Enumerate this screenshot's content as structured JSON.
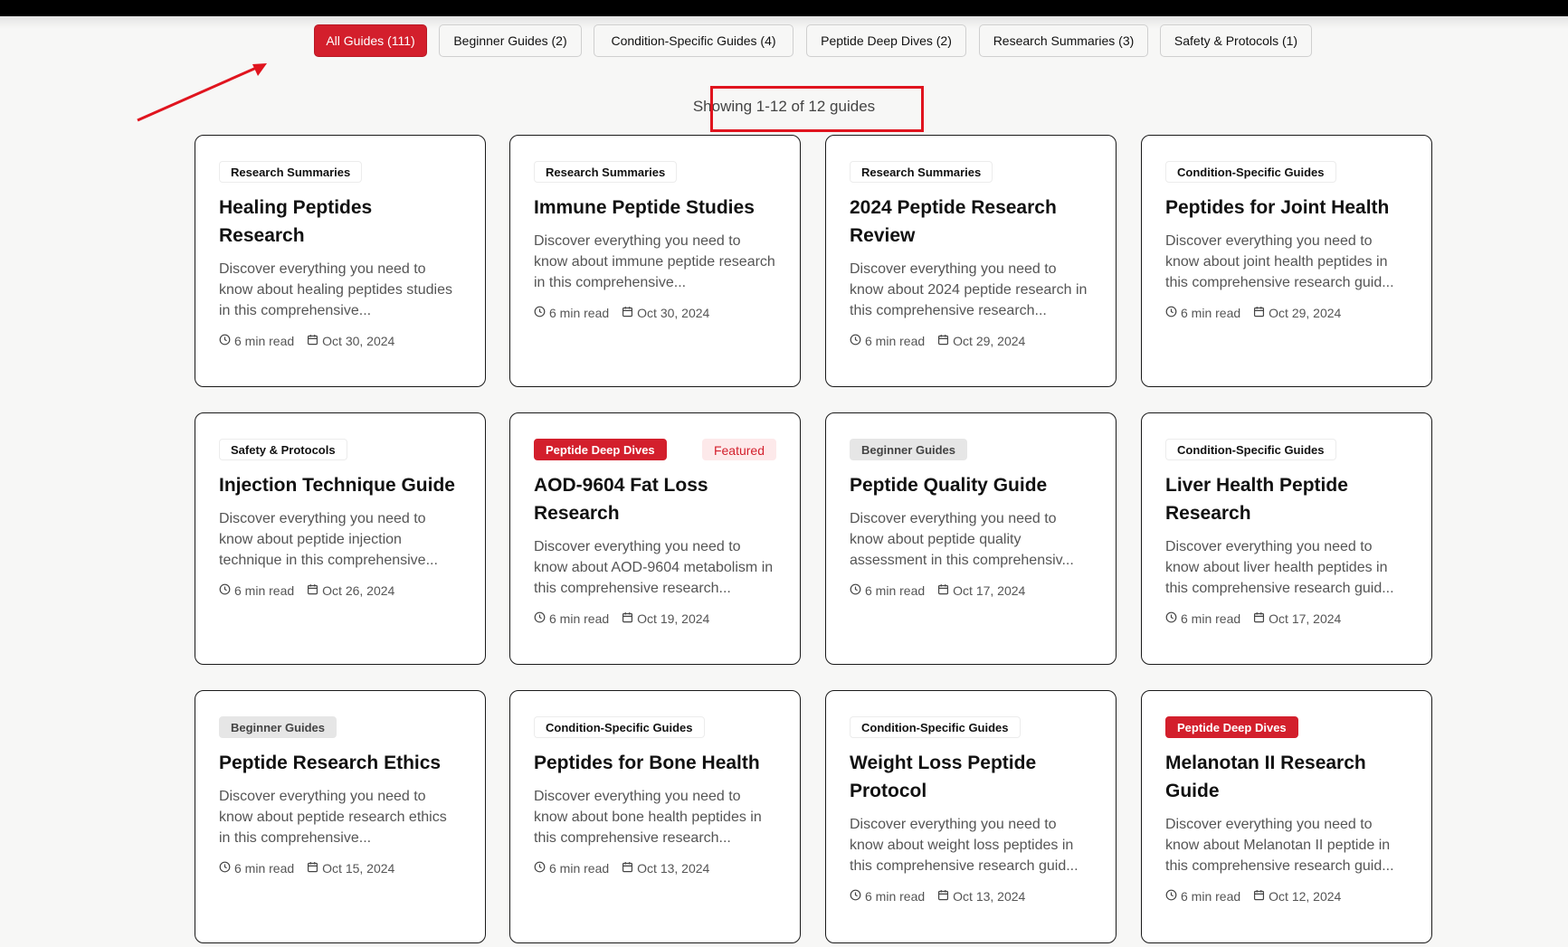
{
  "filters": [
    {
      "label": "All Guides (111)",
      "active": true
    },
    {
      "label": "Beginner Guides (2)",
      "active": false
    },
    {
      "label": "Condition-Specific Guides (4)",
      "active": false
    },
    {
      "label": "Peptide Deep Dives (2)",
      "active": false
    },
    {
      "label": "Research Summaries (3)",
      "active": false
    },
    {
      "label": "Safety & Protocols (1)",
      "active": false
    }
  ],
  "showing_text": "Showing 1-12 of 12 guides",
  "guides": [
    {
      "category": "Research Summaries",
      "category_style": "plain",
      "featured": "",
      "title": "Healing Peptides Research",
      "desc": "Discover everything you need to know about healing peptides studies in this comprehensive...",
      "read_time": "6 min read",
      "date": "Oct 30, 2024"
    },
    {
      "category": "Research Summaries",
      "category_style": "plain",
      "featured": "",
      "title": "Immune Peptide Studies",
      "desc": "Discover everything you need to know about immune peptide research in this comprehensive...",
      "read_time": "6 min read",
      "date": "Oct 30, 2024"
    },
    {
      "category": "Research Summaries",
      "category_style": "plain",
      "featured": "",
      "title": "2024 Peptide Research Review",
      "desc": "Discover everything you need to know about 2024 peptide research in this comprehensive research...",
      "read_time": "6 min read",
      "date": "Oct 29, 2024"
    },
    {
      "category": "Condition-Specific Guides",
      "category_style": "plain",
      "featured": "",
      "title": "Peptides for Joint Health",
      "desc": "Discover everything you need to know about joint health peptides in this comprehensive research guid...",
      "read_time": "6 min read",
      "date": "Oct 29, 2024"
    },
    {
      "category": "Safety & Protocols",
      "category_style": "plain",
      "featured": "",
      "title": "Injection Technique Guide",
      "desc": "Discover everything you need to know about peptide injection technique in this comprehensive...",
      "read_time": "6 min read",
      "date": "Oct 26, 2024"
    },
    {
      "category": "Peptide Deep Dives",
      "category_style": "red",
      "featured": "Featured",
      "title": "AOD-9604 Fat Loss Research",
      "desc": "Discover everything you need to know about AOD-9604 metabolism in this comprehensive research...",
      "read_time": "6 min read",
      "date": "Oct 19, 2024"
    },
    {
      "category": "Beginner Guides",
      "category_style": "gray",
      "featured": "",
      "title": "Peptide Quality Guide",
      "desc": "Discover everything you need to know about peptide quality assessment in this comprehensiv...",
      "read_time": "6 min read",
      "date": "Oct 17, 2024"
    },
    {
      "category": "Condition-Specific Guides",
      "category_style": "plain",
      "featured": "",
      "title": "Liver Health Peptide Research",
      "desc": "Discover everything you need to know about liver health peptides in this comprehensive research guid...",
      "read_time": "6 min read",
      "date": "Oct 17, 2024"
    },
    {
      "category": "Beginner Guides",
      "category_style": "gray",
      "featured": "",
      "title": "Peptide Research Ethics",
      "desc": "Discover everything you need to know about peptide research ethics in this comprehensive...",
      "read_time": "6 min read",
      "date": "Oct 15, 2024"
    },
    {
      "category": "Condition-Specific Guides",
      "category_style": "plain",
      "featured": "",
      "title": "Peptides for Bone Health",
      "desc": "Discover everything you need to know about bone health peptides in this comprehensive research...",
      "read_time": "6 min read",
      "date": "Oct 13, 2024"
    },
    {
      "category": "Condition-Specific Guides",
      "category_style": "plain",
      "featured": "",
      "title": "Weight Loss Peptide Protocol",
      "desc": "Discover everything you need to know about weight loss peptides in this comprehensive research guid...",
      "read_time": "6 min read",
      "date": "Oct 13, 2024"
    },
    {
      "category": "Peptide Deep Dives",
      "category_style": "red",
      "featured": "",
      "title": "Melanotan II Research Guide",
      "desc": "Discover everything you need to know about Melanotan II peptide in this comprehensive research guid...",
      "read_time": "6 min read",
      "date": "Oct 12, 2024"
    }
  ],
  "colors": {
    "accent": "#d31f2c",
    "annotation": "#e0141e"
  },
  "icons": {
    "read_time": "clock-icon",
    "date": "calendar-icon"
  }
}
